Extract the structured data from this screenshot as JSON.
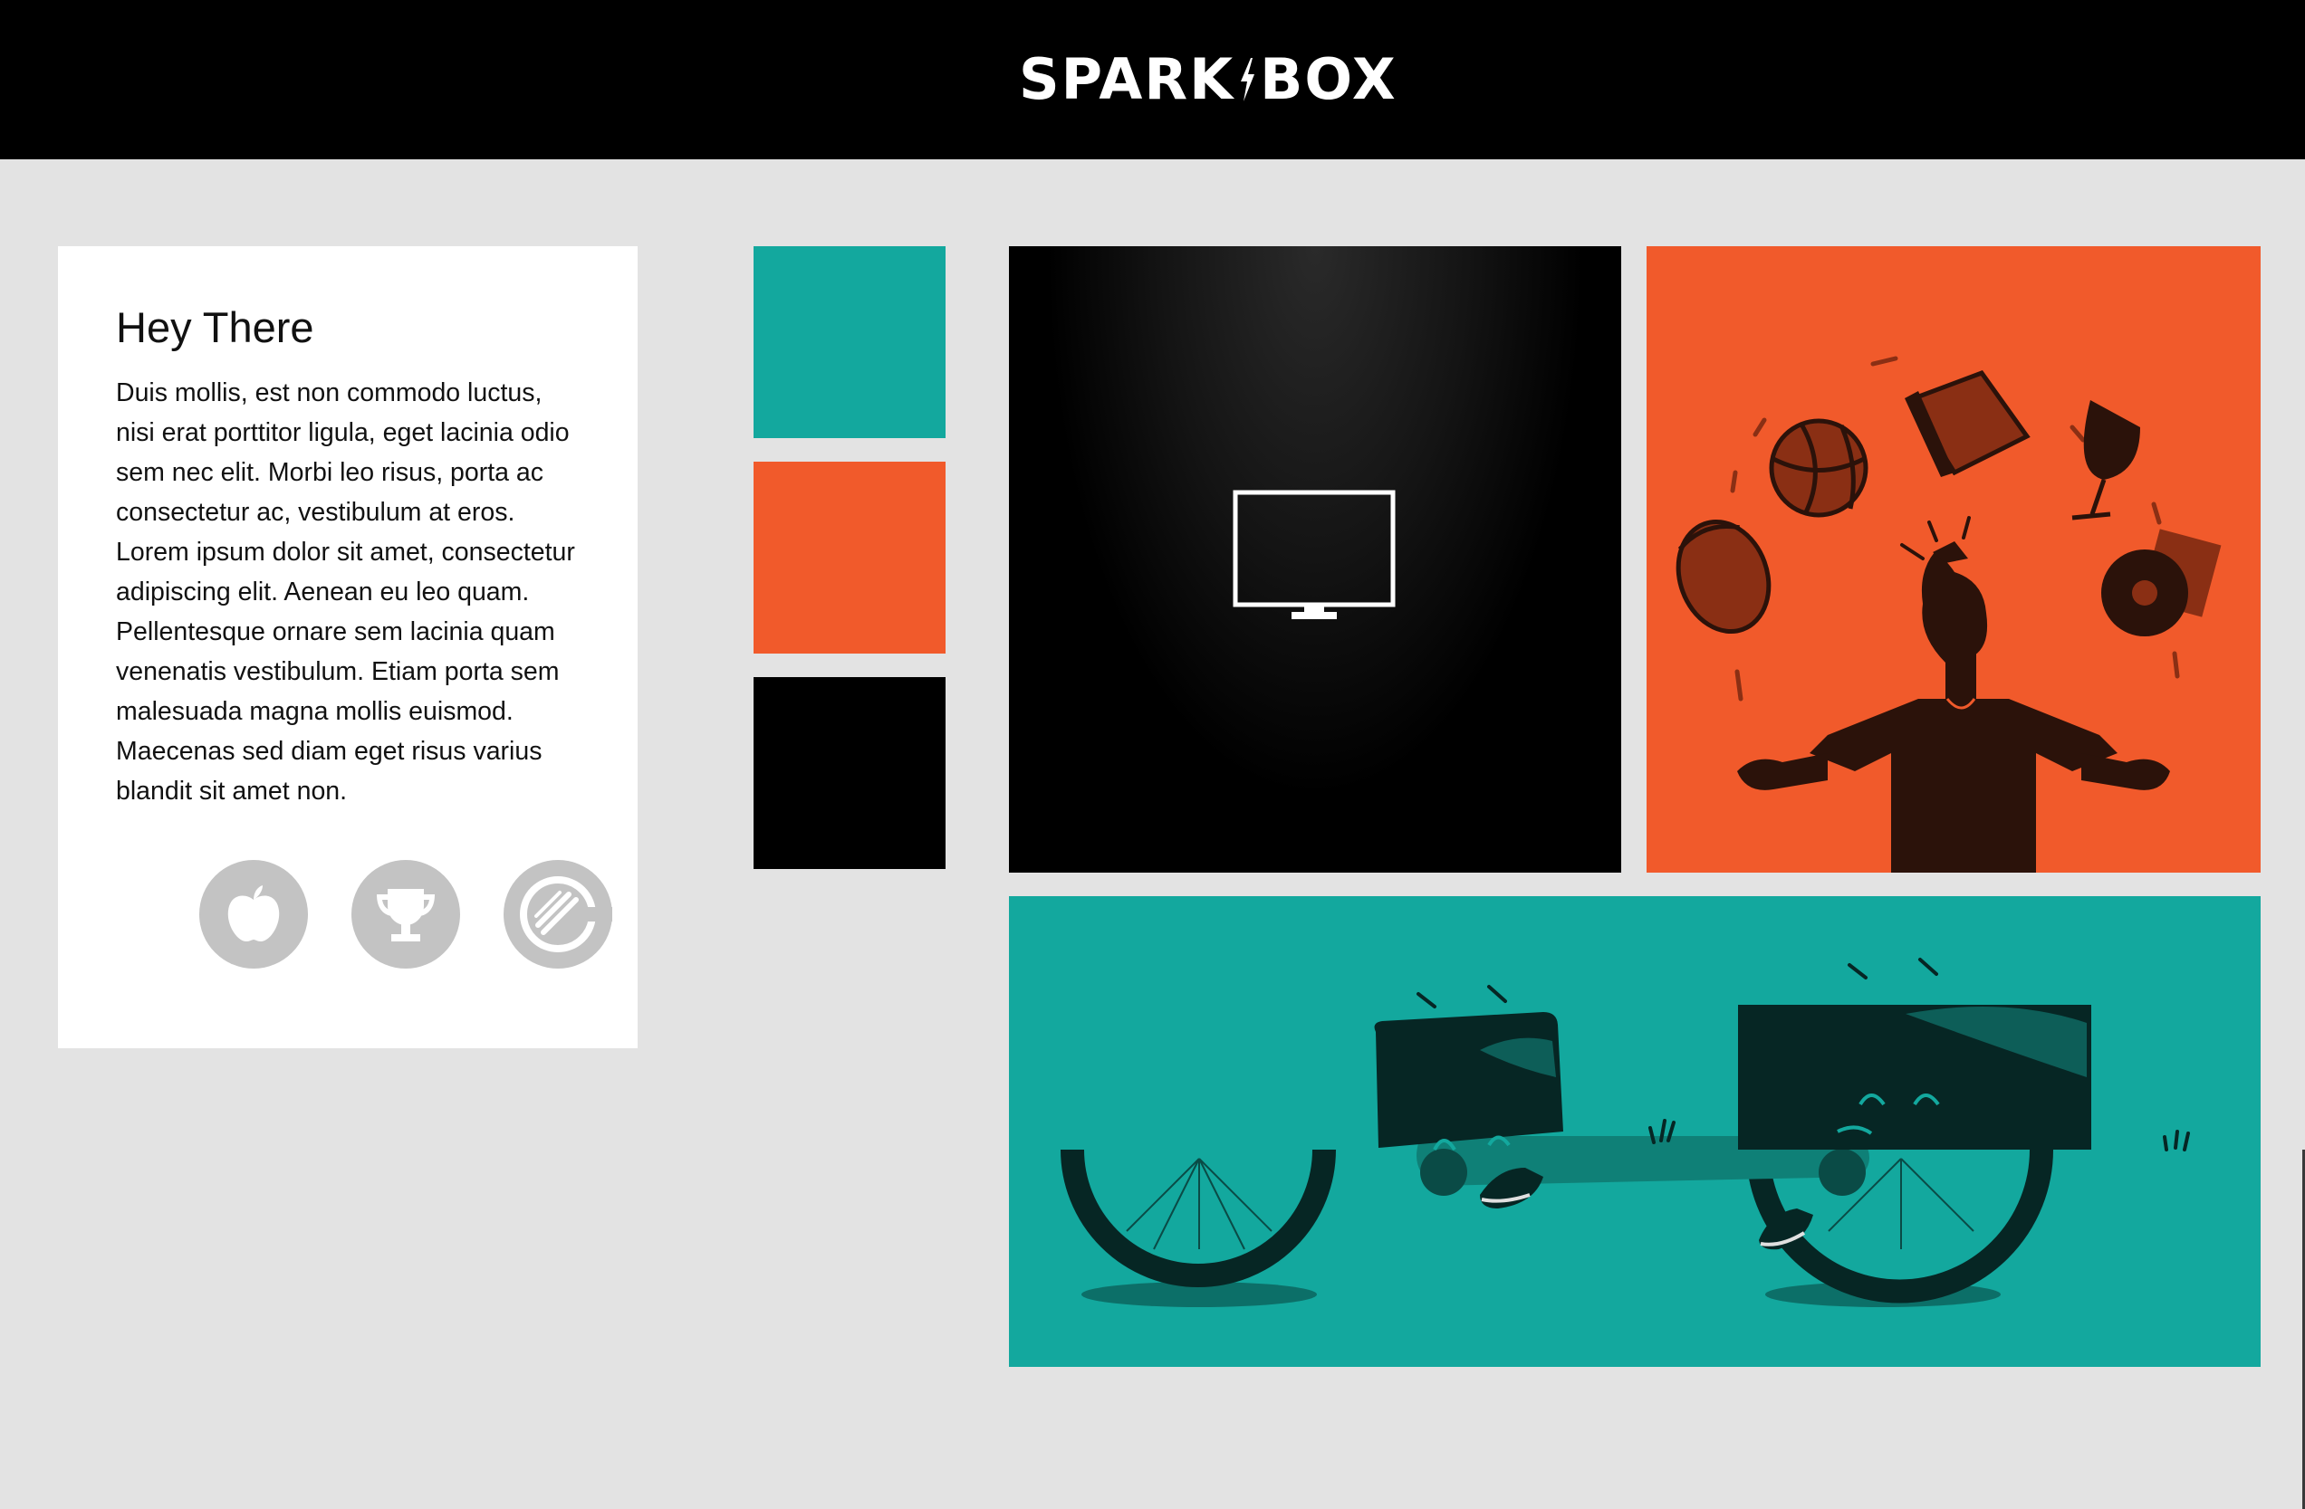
{
  "header": {
    "logo_left": "SPARK",
    "logo_right": "BOX",
    "background_color": "#000000"
  },
  "card": {
    "title": "Hey There",
    "body": "Duis mollis, est non commodo luctus, nisi erat porttitor ligula, eget lacinia odio sem nec elit. Morbi leo risus, porta ac consectetur ac, vestibulum at eros. Lorem ipsum dolor sit amet, consectetur adipiscing elit. Aenean eu leo quam. Pellentesque ornare sem lacinia quam venenatis vestibulum. Etiam porta sem malesuada magna mollis euismod. Maecenas sed diam eget risus varius blandit sit amet non.",
    "badges": [
      {
        "icon": "apple-icon"
      },
      {
        "icon": "trophy-icon"
      },
      {
        "icon": "bacon-icon"
      }
    ]
  },
  "swatches": [
    {
      "name": "teal",
      "color": "#13a89e"
    },
    {
      "name": "orange",
      "color": "#f15a2b"
    },
    {
      "name": "black",
      "color": "#000000"
    }
  ],
  "tiles": {
    "monitor": {
      "icon": "monitor-icon",
      "color": "#000000"
    },
    "juggler": {
      "illustration": "juggler-illustration",
      "color": "#f15a2b"
    },
    "cargo_bike": {
      "illustration": "cargo-bike-illustration",
      "color": "#13a89e"
    }
  },
  "colors": {
    "page_background": "#e3e3e3",
    "badge_gray": "#c3c3c3",
    "dark_ink": "#2b120a",
    "teal_ink": "#062624"
  }
}
